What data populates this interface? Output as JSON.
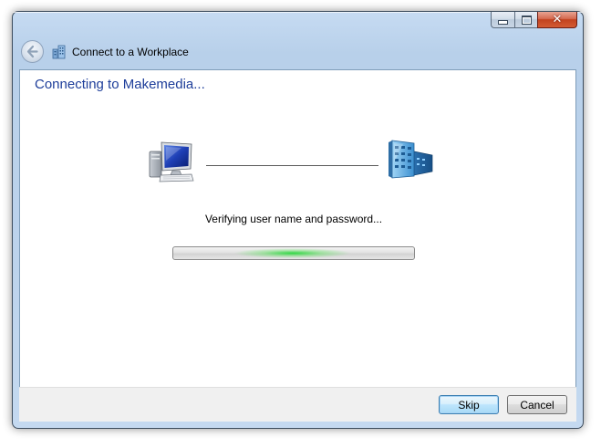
{
  "window": {
    "caption_buttons": {
      "minimize_icon": "minimize-icon",
      "maximize_icon": "maximize-icon",
      "close_icon": "close-icon",
      "close_glyph": "✕"
    }
  },
  "nav": {
    "back_icon": "back-arrow-icon",
    "wizard_icon": "workplace-network-icon",
    "title": "Connect to a Workplace"
  },
  "main": {
    "heading": "Connecting to Makemedia...",
    "computer_icon": "computer-icon",
    "server_icon": "server-icon",
    "status": "Verifying user name and password...",
    "progress": {
      "mode": "indeterminate",
      "glow_color": "#28d73c"
    }
  },
  "footer": {
    "skip_label": "Skip",
    "cancel_label": "Cancel"
  },
  "colors": {
    "heading": "#1e3e9a",
    "frame": "#bcd3ec",
    "close_button": "#c2421f"
  }
}
